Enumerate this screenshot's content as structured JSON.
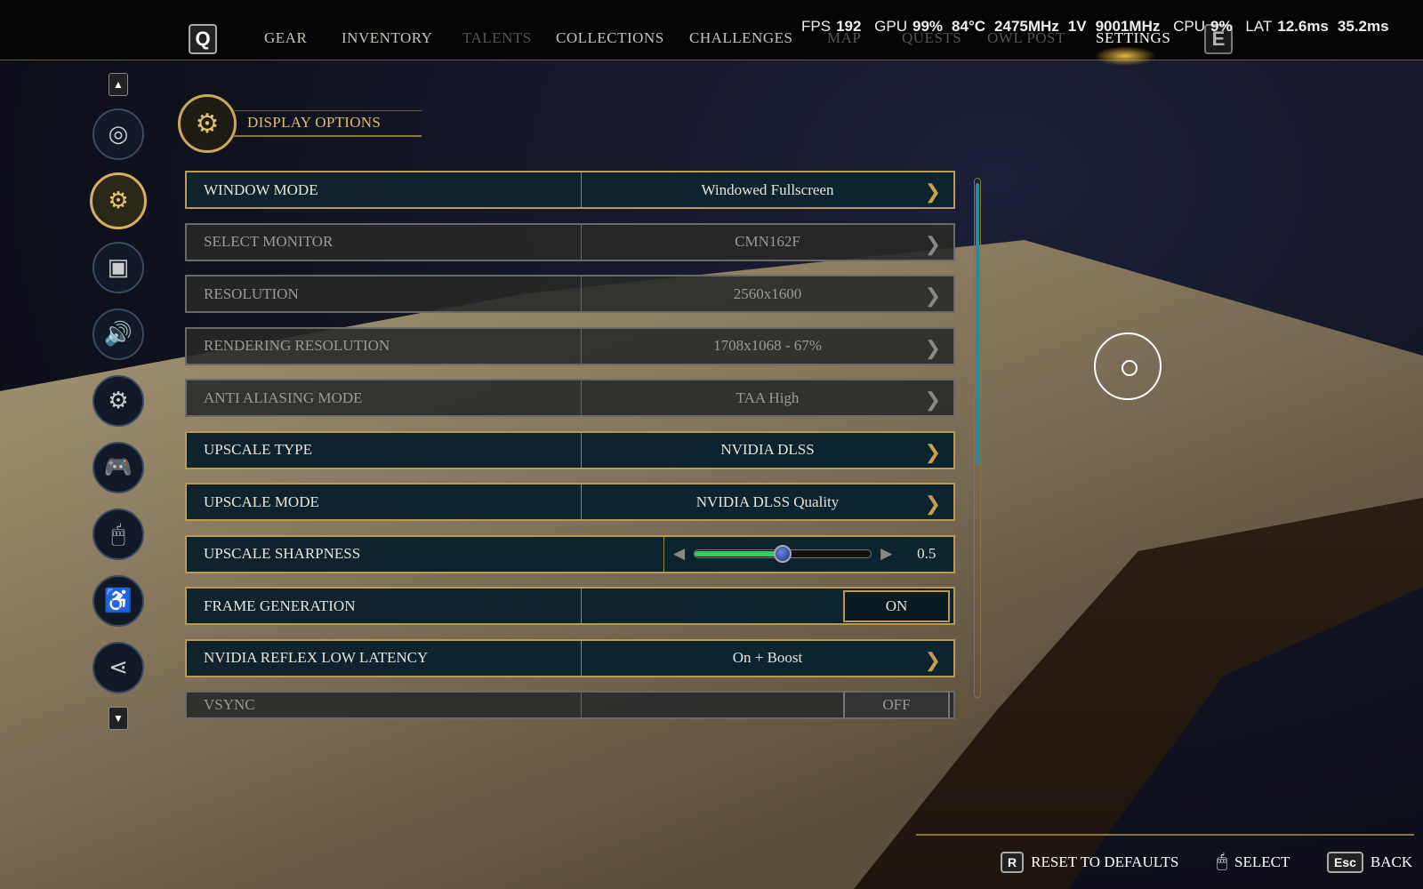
{
  "nav": {
    "q_key": "Q",
    "e_key": "E",
    "tabs": [
      {
        "label": "GEAR",
        "state": "normal"
      },
      {
        "label": "INVENTORY",
        "state": "normal"
      },
      {
        "label": "TALENTS",
        "state": "disabled"
      },
      {
        "label": "COLLECTIONS",
        "state": "normal"
      },
      {
        "label": "CHALLENGES",
        "state": "normal"
      },
      {
        "label": "MAP",
        "state": "dim"
      },
      {
        "label": "QUESTS",
        "state": "dim"
      },
      {
        "label": "OWL POST",
        "state": "dim"
      },
      {
        "label": "SETTINGS",
        "state": "active"
      }
    ]
  },
  "hud": {
    "fps_label": "FPS",
    "fps": "192",
    "gpu_label": "GPU",
    "gpu_util": "99%",
    "gpu_temp": "84°C",
    "gpu_clock": "2475MHz",
    "voltage": "1V",
    "mem_clock": "9001MHz",
    "cpu_label": "CPU",
    "cpu_util": "9%",
    "lat_label": "LAT",
    "lat1": "12.6ms",
    "lat2": "35.2ms"
  },
  "sidebar": {
    "items": [
      {
        "icon": "disc-icon"
      },
      {
        "icon": "display-settings-icon",
        "active": true
      },
      {
        "icon": "graphics-icon"
      },
      {
        "icon": "audio-icon"
      },
      {
        "icon": "controls-gear-icon"
      },
      {
        "icon": "gamepad-icon"
      },
      {
        "icon": "mouse-icon"
      },
      {
        "icon": "accessibility-icon"
      },
      {
        "icon": "social-icon"
      }
    ]
  },
  "section": {
    "title": "DISPLAY OPTIONS"
  },
  "settings": [
    {
      "label": "WINDOW MODE",
      "value": "Windowed Fullscreen",
      "enabled": true
    },
    {
      "label": "SELECT MONITOR",
      "value": "CMN162F",
      "enabled": false
    },
    {
      "label": "RESOLUTION",
      "value": "2560x1600",
      "enabled": false
    },
    {
      "label": "RENDERING RESOLUTION",
      "value": "1708x1068 - 67%",
      "enabled": false
    },
    {
      "label": "ANTI ALIASING MODE",
      "value": "TAA High",
      "enabled": false
    },
    {
      "label": "UPSCALE TYPE",
      "value": "NVIDIA DLSS",
      "enabled": true
    },
    {
      "label": "UPSCALE MODE",
      "value": "NVIDIA DLSS Quality",
      "enabled": true
    },
    {
      "label": "UPSCALE SHARPNESS",
      "value": "0.5",
      "slider_fraction": 0.5,
      "enabled": true
    },
    {
      "label": "FRAME GENERATION",
      "value": "ON",
      "enabled": true
    },
    {
      "label": "NVIDIA REFLEX LOW LATENCY",
      "value": "On + Boost",
      "enabled": true
    },
    {
      "label": "VSYNC",
      "value": "OFF",
      "enabled": false
    }
  ],
  "footer": {
    "reset_key": "R",
    "reset": "RESET TO DEFAULTS",
    "select": "SELECT",
    "back_key": "Esc",
    "back": "BACK"
  },
  "colors": {
    "accent": "#c9a858",
    "slider_fill": "#2ed060",
    "scroll_thumb": "#2a8a98"
  }
}
